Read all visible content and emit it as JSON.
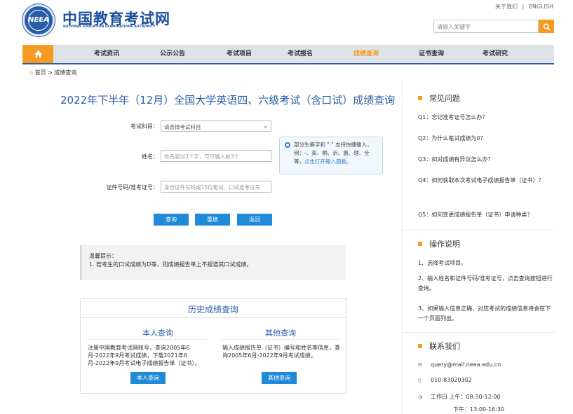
{
  "header": {
    "top_links": [
      "关于我们",
      "|",
      "ENGLISH"
    ],
    "logo_text": "NEEA",
    "site_title": "中国教育考试网",
    "site_subtitle": "NATIONAL EDUCATION EXAMINATIONS AUTHORITY",
    "search_placeholder": "请输入关键字",
    "search_icon": "search-icon"
  },
  "nav": {
    "home_icon": "home-icon",
    "items": [
      "考试资讯",
      "公示公告",
      "考试项目",
      "考试报名",
      "成绩查询",
      "证书查询",
      "考试研究"
    ],
    "active_index": 4,
    "colors": {
      "bar": "#dfe3e8",
      "accent": "#f59a23",
      "active": "#f59a23",
      "border": "#2a5da8"
    }
  },
  "breadcrumb": {
    "home": "首页",
    "sep": ">",
    "current": "成绩查询"
  },
  "main": {
    "title": "2022年下半年（12月）全国大学英语四、六级考试（含口试）成绩查询",
    "form": {
      "subject_label": "考试科目：",
      "subject_value": "请选择考试科目",
      "name_label": "姓名：",
      "name_placeholder": "姓名超过3个字，可只输入前3个",
      "id_label": "证件号码/准考证号：",
      "id_placeholder": "身份证件号码或15位笔试、口试准考证号",
      "tip_text": "部分生僻字和 \"·\" 支持快捷输入，例：-、栾、桐、䜣、惠、理、全等，",
      "tip_link": "点击打开输入面板。"
    },
    "buttons": {
      "query": "查询",
      "reset": "重填",
      "back": "返回"
    },
    "notice": {
      "title": "温馨提示：",
      "text": "1. 若考生的口试成绩为D等，则成绩报告单上不报道其口试成绩。"
    },
    "history": {
      "title": "历史成绩查询",
      "self": {
        "title": "本人查询",
        "desc": "注册中国教育考试网账号，查询2005年6月-2022年9月考试成绩，下载2021年6月-2022年9月考试电子成绩报告单（证书）。",
        "button": "本人查询"
      },
      "other": {
        "title": "其他查询",
        "desc": "输入成绩报告单（证书）编号和姓名等信息，查询2005年6月-2022年9月考试成绩。",
        "button": "其他查询"
      }
    }
  },
  "sidebar": {
    "faq_title": "常见问题",
    "faqs": [
      "Q1：忘记准考证号怎么办？",
      "Q2：为什么笔试成绩为0？",
      "Q3：如对成绩有异议怎么办？",
      "Q4：如何获取本次考试电子成绩报告单（证书）？",
      "Q5：如何变更成绩报告单（证书）申请种类？"
    ],
    "ops_title": "操作说明",
    "ops": [
      "1、选择考试项目。",
      "2、输入姓名和证件号码/准考证号，点击查询按钮进行查询。",
      "3、如果输入信息正确，对应考试的成绩信息将会在下一个页面列出。"
    ],
    "contact_title": "联系我们",
    "contact": {
      "email": "query@mail.neea.edu.cn",
      "phone": "010-83020302",
      "hours_am": "工作日 上午：08:30-12:00",
      "hours_pm": "下午：13:00-16:30",
      "icons": [
        "mail-icon",
        "phone-icon",
        "clock-icon"
      ]
    }
  }
}
